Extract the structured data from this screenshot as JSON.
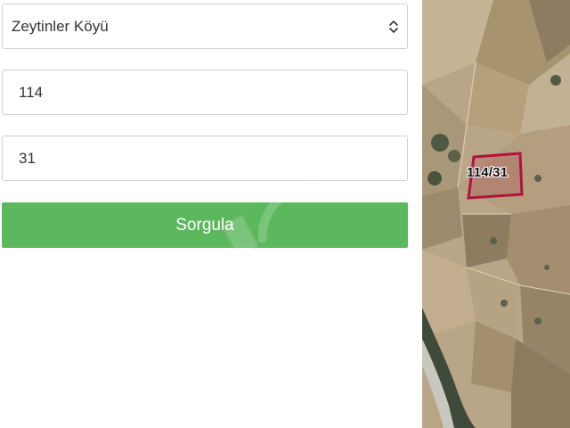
{
  "form": {
    "village_select": {
      "value": "Zeytinler Köyü",
      "icon": "up-down-chevron-icon"
    },
    "ada_input": {
      "value": "114"
    },
    "parsel_input": {
      "value": "31"
    },
    "submit_label": "Sorgula"
  },
  "map": {
    "parcel_label": "114/31",
    "parcel_color": "#b3123a"
  },
  "colors": {
    "submit_bg": "#5cb85c",
    "border": "#cfcfcf"
  }
}
